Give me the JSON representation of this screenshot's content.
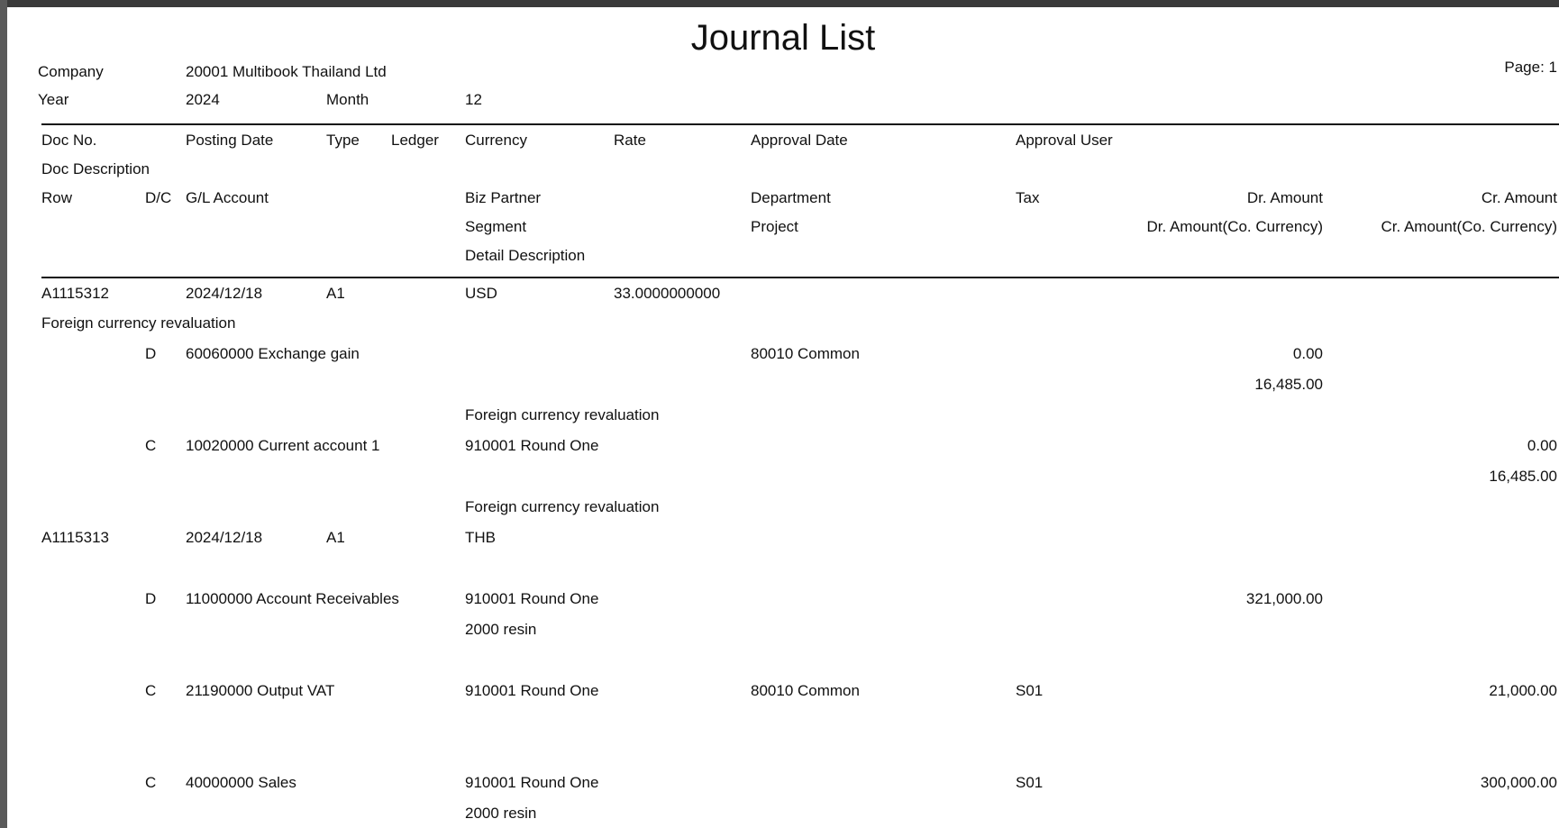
{
  "report": {
    "title": "Journal List",
    "page": "Page: 1",
    "company_label": "Company",
    "company_value": "20001 Multibook Thailand  Ltd",
    "year_label": "Year",
    "year_value": "2024",
    "month_label": "Month",
    "month_value": "12"
  },
  "headers": {
    "row1": [
      "Doc No.",
      "Posting Date",
      "Type",
      "Ledger",
      "Currency",
      "Rate",
      "Approval Date",
      "Approval User"
    ],
    "doc_description": "Doc Description",
    "row3": [
      "Row",
      "D/C",
      "G/L Account",
      "Biz Partner",
      "Department",
      "Tax",
      "Dr. Amount",
      "Cr. Amount"
    ],
    "row4": [
      "Segment",
      "Project",
      "Dr. Amount(Co. Currency)",
      "Cr. Amount(Co. Currency)"
    ],
    "detail_description": "Detail Description"
  },
  "docs": [
    {
      "doc_no": "A1115312",
      "posting_date": "2024/12/18",
      "type": "A1",
      "currency": "USD",
      "rate": "33.0000000000",
      "description": "Foreign currency revaluation",
      "lines": [
        {
          "dc": "D",
          "account": "60060000 Exchange gain",
          "department": "80010 Common",
          "dr_amount": "0.00",
          "dr_amount_co": "16,485.00",
          "detail": "Foreign currency revaluation"
        },
        {
          "dc": "C",
          "account": "10020000 Current account 1",
          "biz_partner": "910001 Round One",
          "cr_amount": "0.00",
          "cr_amount_co": "16,485.00",
          "detail": "Foreign currency revaluation"
        }
      ]
    },
    {
      "doc_no": "A1115313",
      "posting_date": "2024/12/18",
      "type": "A1",
      "currency": "THB",
      "lines": [
        {
          "dc": "D",
          "account": "11000000 Account Receivables",
          "biz_partner": "910001 Round One",
          "dr_amount": "321,000.00",
          "segment": "2000 resin"
        },
        {
          "dc": "C",
          "account": "21190000 Output VAT",
          "biz_partner": "910001 Round One",
          "department": "80010 Common",
          "tax": "S01",
          "cr_amount": "21,000.00"
        },
        {
          "dc": "C",
          "account": "40000000 Sales",
          "biz_partner": "910001 Round One",
          "tax": "S01",
          "cr_amount": "300,000.00",
          "segment": "2000 resin"
        }
      ]
    }
  ]
}
